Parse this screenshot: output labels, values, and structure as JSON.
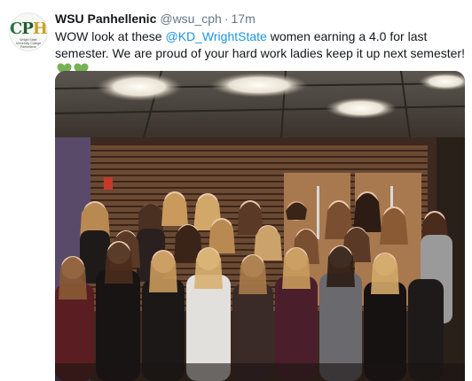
{
  "tweet": {
    "display_name": "WSU Panhellenic",
    "handle": "@wsu_cph",
    "separator": "·",
    "time": "17m",
    "text_before": "WOW look at these ",
    "mention": "@KD_WrightState",
    "text_after": " women earning a 4.0 for last semester. We are proud of your hard work ladies keep it up next semester! ",
    "emoji": [
      "green-heart-icon",
      "green-heart-icon"
    ]
  },
  "avatar": {
    "logo_letters": [
      "C",
      "P",
      "H"
    ],
    "logo_subtext": "Wright State University College Panhellenic"
  },
  "colors": {
    "mention": "#1b95e0",
    "heart": "#77b255",
    "handle": "#657786"
  }
}
